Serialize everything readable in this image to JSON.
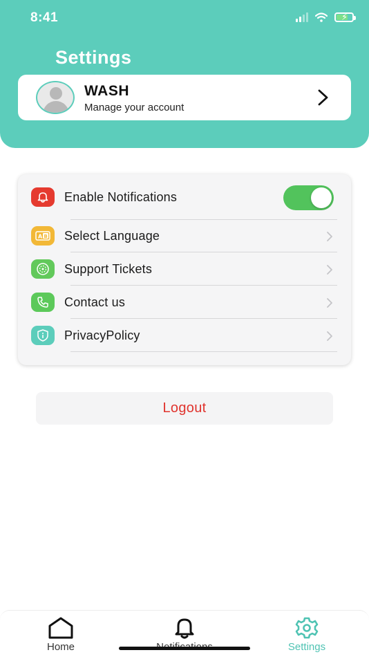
{
  "status_bar": {
    "time": "8:41",
    "icons": [
      "cellular-signal-icon",
      "wifi-icon",
      "battery-charging-icon"
    ]
  },
  "header": {
    "title": "Settings"
  },
  "account": {
    "name": "WASH",
    "subtitle": "Manage your account",
    "avatar_icon": "person-placeholder-icon",
    "chevron_icon": "chevron-right-icon"
  },
  "settings": {
    "items": [
      {
        "label": "Enable Notifications",
        "icon": "bell-icon",
        "icon_color": "#e53a2f",
        "control": "toggle",
        "toggle_on": true
      },
      {
        "label": "Select  Language",
        "icon": "language-icon",
        "icon_color": "#f2b837",
        "control": "chevron"
      },
      {
        "label": "Support Tickets",
        "icon": "ticket-icon",
        "icon_color": "#62c95b",
        "control": "chevron"
      },
      {
        "label": "Contact us",
        "icon": "phone-icon",
        "icon_color": "#5cc95a",
        "control": "chevron"
      },
      {
        "label": "PrivacyPolicy",
        "icon": "shield-info-icon",
        "icon_color": "#5ccdbb",
        "control": "chevron"
      }
    ]
  },
  "logout": {
    "label": "Logout",
    "color": "#e0332d"
  },
  "tabbar": {
    "tabs": [
      {
        "label": "Home",
        "icon": "home-icon",
        "active": false
      },
      {
        "label": "Notifications",
        "icon": "bell-icon",
        "active": false
      },
      {
        "label": "Settings",
        "icon": "gear-icon",
        "active": true
      }
    ]
  },
  "colors": {
    "accent": "#5ccdbb",
    "toggle_on": "#52c35c",
    "active_tab": "#4fc3b3"
  }
}
